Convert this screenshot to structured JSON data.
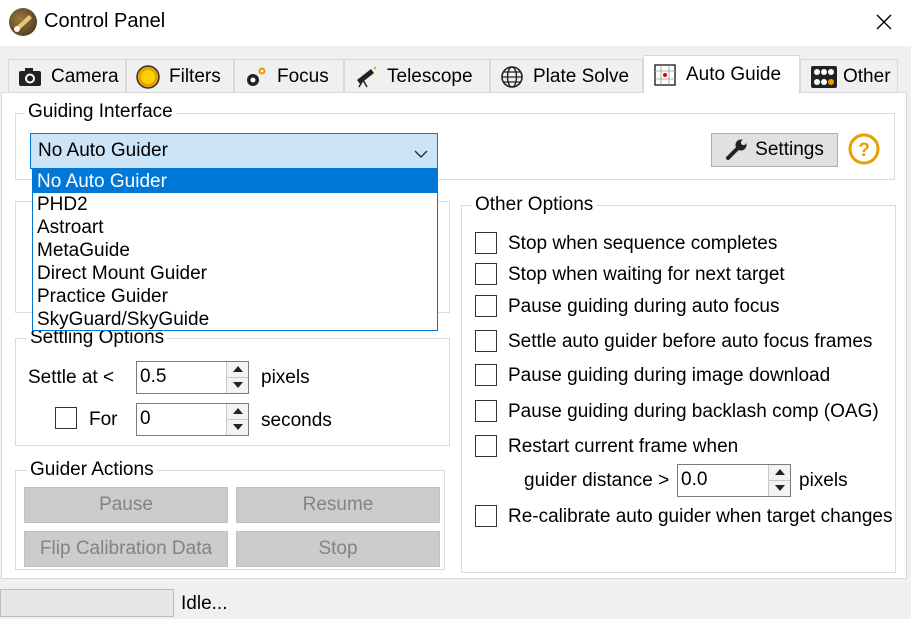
{
  "window": {
    "title": "Control Panel"
  },
  "tabs": [
    {
      "label": "Camera",
      "icon": "camera-icon"
    },
    {
      "label": "Filters",
      "icon": "filter-wheel-icon"
    },
    {
      "label": "Focus",
      "icon": "gear-icon"
    },
    {
      "label": "Telescope",
      "icon": "telescope-icon"
    },
    {
      "label": "Plate Solve",
      "icon": "globe-icon"
    },
    {
      "label": "Auto Guide",
      "icon": "crosshair-grid-icon",
      "active": true
    },
    {
      "label": "Other",
      "icon": "dots-grid-icon"
    }
  ],
  "guiding_interface": {
    "label": "Guiding Interface",
    "selected": "No Auto Guider",
    "options": [
      "No Auto Guider",
      "PHD2",
      "Astroart",
      "MetaGuide",
      "Direct Mount Guider",
      "Practice Guider",
      "SkyGuard/SkyGuide"
    ],
    "settings_label": "Settings"
  },
  "settle": {
    "label": "Settling Options",
    "settle_at_label": "Settle at <",
    "settle_value": "0.5",
    "pixels_label": "pixels",
    "for_label": "For",
    "for_value": "0",
    "seconds_label": "seconds"
  },
  "guider_actions": {
    "label": "Guider Actions",
    "pause": "Pause",
    "resume": "Resume",
    "flip": "Flip Calibration Data",
    "stop": "Stop"
  },
  "other_options": {
    "label": "Other Options",
    "items": [
      "Stop when sequence completes",
      "Stop when waiting for next target",
      "Pause guiding during auto focus",
      "Settle auto guider before auto focus frames",
      "Pause guiding during image download",
      "Pause guiding during backlash comp (OAG)",
      "Restart current frame when"
    ],
    "distance_label": "guider distance >",
    "distance_value": "0.0",
    "distance_unit": "pixels",
    "recalibrate": "Re-calibrate auto guider when target changes"
  },
  "status": {
    "text": "Idle..."
  },
  "colors": {
    "accent": "#0078d7",
    "selection": "#cce4f7"
  }
}
